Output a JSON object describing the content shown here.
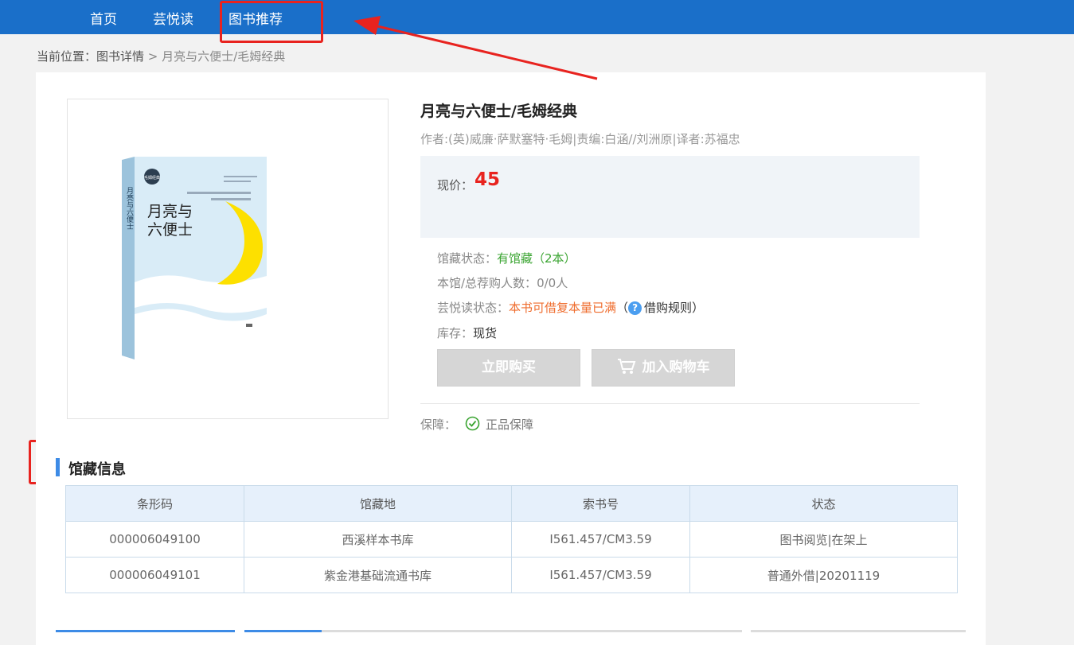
{
  "nav": {
    "items": [
      "首页",
      "芸悦读",
      "图书推荐"
    ]
  },
  "breadcrumb": {
    "prefix": "当前位置：",
    "link": "图书详情",
    "sep": " > ",
    "current": "月亮与六便士/毛姆经典"
  },
  "book": {
    "title": "月亮与六便士/毛姆经典",
    "author": "作者:(英)威廉·萨默塞特·毛姆|责编:白涵//刘洲原|译者:苏福忠",
    "cover": {
      "title_line1": "月亮与",
      "title_line2": "六便士",
      "spine_text": "月亮与六便士",
      "badge": "毛姆经典"
    }
  },
  "price": {
    "label": "现价：",
    "value": "45"
  },
  "status": {
    "holding_label": "馆藏状态：",
    "holding_value": "有馆藏（2本）",
    "buyers_label": "本馆/总荐购人数：",
    "buyers_value": "0/0人",
    "yun_label": "芸悦读状态：",
    "yun_value": "本书可借复本量已满",
    "rules_open": "（",
    "rules_icon": "?",
    "rules_link": "借购规则",
    "rules_close": "）",
    "stock_label": "库存：",
    "stock_value": "现货"
  },
  "buttons": {
    "buy": "立即购买",
    "cart": "加入购物车"
  },
  "guarantee": {
    "label": "保障：",
    "value": "正品保障"
  },
  "holdings": {
    "title": "馆藏信息",
    "columns": [
      "条形码",
      "馆藏地",
      "索书号",
      "状态"
    ],
    "rows": [
      [
        "000006049100",
        "西溪样本书库",
        "I561.457/CM3.59",
        "图书阅览|在架上"
      ],
      [
        "000006049101",
        "紫金港基础流通书库",
        "I561.457/CM3.59",
        "普通外借|20201119"
      ]
    ]
  },
  "colors": {
    "nav": "#1a6fc9",
    "price": "#e8231f",
    "green": "#3aa431",
    "orange": "#ef6d2e",
    "annotation": "#e8231f"
  }
}
